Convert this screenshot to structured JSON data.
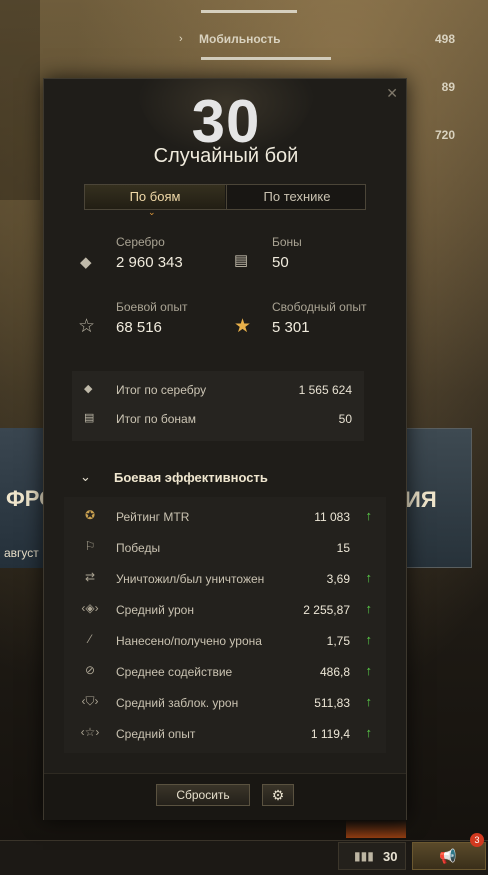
{
  "background": {
    "stats": [
      {
        "label": "",
        "value": ""
      },
      {
        "label": "Мобильность",
        "value": "498"
      },
      {
        "label": "",
        "value": "89"
      },
      {
        "label": "",
        "value": "720"
      }
    ],
    "left_banner": {
      "title": "ФРО",
      "subtitle": "август"
    },
    "right_banner": {
      "title": "ИЯ"
    }
  },
  "panel": {
    "level": "30",
    "battle_type": "Случайный бой",
    "tabs": [
      {
        "label": "По боям",
        "active": true
      },
      {
        "label": "По технике",
        "active": false
      }
    ],
    "resources": [
      {
        "icon": "silver-icon",
        "label": "Серебро",
        "value": "2 960 343"
      },
      {
        "icon": "bonds-icon",
        "label": "Боны",
        "value": "50"
      },
      {
        "icon": "star-outline-icon",
        "label": "Боевой опыт",
        "value": "68 516"
      },
      {
        "icon": "star-filled-icon",
        "label": "Свободный опыт",
        "value": "5 301"
      }
    ],
    "summary": [
      {
        "icon": "silver-icon",
        "label": "Итог по серебру",
        "value": "1 565 624"
      },
      {
        "icon": "bonds-icon",
        "label": "Итог по бонам",
        "value": "50"
      }
    ],
    "efficiency": {
      "title": "Боевая эффективность",
      "rows": [
        {
          "icon": "mtr-rating-icon",
          "label": "Рейтинг MTR",
          "value": "11 083",
          "trend": "up"
        },
        {
          "icon": "flag-icon",
          "label": "Победы",
          "value": "15",
          "trend": ""
        },
        {
          "icon": "destroyed-icon",
          "label": "Уничтожил/был уничтожен",
          "value": "3,69",
          "trend": "up"
        },
        {
          "icon": "damage-icon",
          "label": "Средний урон",
          "value": "2 255,87",
          "trend": "up"
        },
        {
          "icon": "damage-ratio-icon",
          "label": "Нанесено/получено урона",
          "value": "1,75",
          "trend": "up"
        },
        {
          "icon": "assist-icon",
          "label": "Среднее содействие",
          "value": "486,8",
          "trend": "up"
        },
        {
          "icon": "blocked-icon",
          "label": "Средний заблок. урон",
          "value": "511,83",
          "trend": "up"
        },
        {
          "icon": "avg-xp-icon",
          "label": "Средний опыт",
          "value": "1 119,4",
          "trend": "up"
        }
      ]
    },
    "footer": {
      "reset_label": "Сбросить"
    }
  },
  "bottom_bar": {
    "tank_count": "30",
    "notification_count": "3"
  },
  "colors": {
    "accent_orange": "#e09a3a",
    "trend_up_green": "#5bd04a"
  }
}
